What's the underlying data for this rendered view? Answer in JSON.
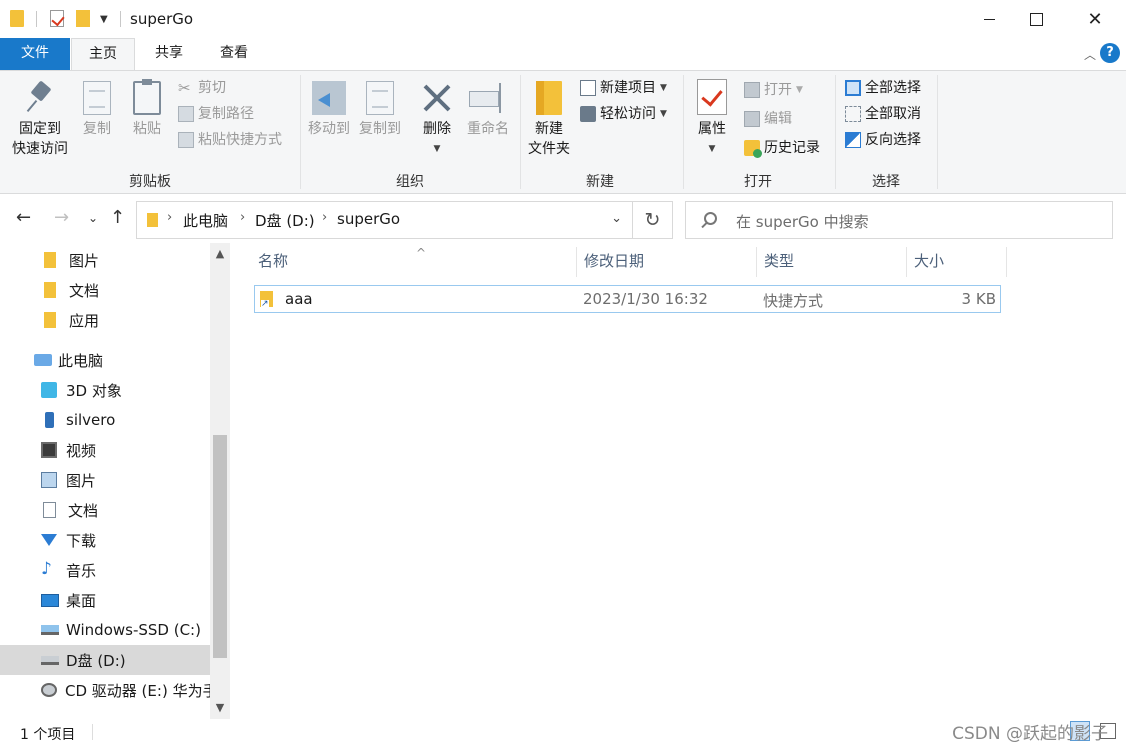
{
  "window": {
    "title": "superGo",
    "min_label": "",
    "close_label": "✕"
  },
  "ribbon_tabs": {
    "file": "文件",
    "home": "主页",
    "share": "共享",
    "view": "查看"
  },
  "ribbon": {
    "clipboard": {
      "label": "剪贴板",
      "pin_line1": "固定到",
      "pin_line2": "快速访问",
      "copy": "复制",
      "paste": "粘贴",
      "cut": "剪切",
      "copy_path": "复制路径",
      "paste_shortcut": "粘贴快捷方式"
    },
    "organize": {
      "label": "组织",
      "move_to": "移动到",
      "copy_to": "复制到",
      "delete": "删除",
      "rename": "重命名"
    },
    "new": {
      "label": "新建",
      "new_folder_line1": "新建",
      "new_folder_line2": "文件夹",
      "new_item": "新建项目",
      "easy_access": "轻松访问"
    },
    "open": {
      "label": "打开",
      "properties": "属性",
      "open": "打开",
      "edit": "编辑",
      "history": "历史记录"
    },
    "select": {
      "label": "选择",
      "select_all": "全部选择",
      "select_none": "全部取消",
      "invert": "反向选择"
    }
  },
  "navigation": {
    "breadcrumb": [
      "此电脑",
      "D盘 (D:)",
      "superGo"
    ],
    "search_placeholder": "在 superGo 中搜索"
  },
  "sidebar": {
    "items": [
      {
        "label": "图片",
        "icon": "folder-icon"
      },
      {
        "label": "文档",
        "icon": "folder-icon"
      },
      {
        "label": "应用",
        "icon": "folder-icon"
      },
      {
        "label": "此电脑",
        "icon": "computer-icon"
      },
      {
        "label": "3D 对象",
        "icon": "3d-objects-icon"
      },
      {
        "label": "silvero",
        "icon": "phone-icon"
      },
      {
        "label": "视频",
        "icon": "video-icon"
      },
      {
        "label": "图片",
        "icon": "pictures-icon"
      },
      {
        "label": "文档",
        "icon": "documents-icon"
      },
      {
        "label": "下载",
        "icon": "download-icon"
      },
      {
        "label": "音乐",
        "icon": "music-icon"
      },
      {
        "label": "桌面",
        "icon": "desktop-icon"
      },
      {
        "label": "Windows-SSD (C:)",
        "icon": "windows-drive-icon"
      },
      {
        "label": "D盘 (D:)",
        "icon": "drive-icon",
        "selected": true
      },
      {
        "label": "CD 驱动器 (E:) 华为手",
        "icon": "cd-drive-icon"
      }
    ]
  },
  "file_list": {
    "columns": [
      "名称",
      "修改日期",
      "类型",
      "大小"
    ],
    "rows": [
      {
        "name": "aaa",
        "modified": "2023/1/30 16:32",
        "type": "快捷方式",
        "size": "3 KB"
      }
    ]
  },
  "status": {
    "item_count": "1 个项目",
    "watermark": "CSDN @跃起的影子"
  },
  "colors": {
    "accent": "#1979ca",
    "folder": "#f3c13a",
    "selection_border": "#99c9ef"
  }
}
